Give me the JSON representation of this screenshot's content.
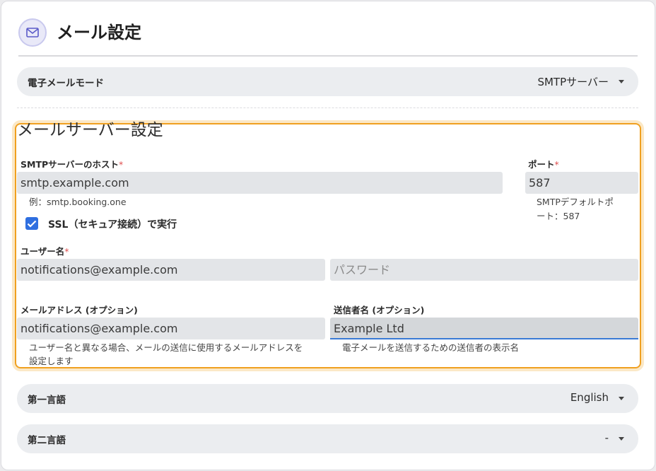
{
  "header": {
    "title": "メール設定",
    "icon": "mail-icon"
  },
  "mode": {
    "label": "電子メールモード",
    "value": "SMTPサーバー"
  },
  "server": {
    "title": "メールサーバー設定",
    "host": {
      "label": "SMTPサーバーのホスト",
      "value": "smtp.example.com",
      "help": "例：smtp.booking.one"
    },
    "port": {
      "label": "ポート",
      "value": "587",
      "help_line1": "SMTPデフォルトポ",
      "help_line2": "ート：587"
    },
    "ssl": {
      "label": "SSL（セキュア接続）で実行",
      "checked": true
    },
    "username": {
      "label": "ユーザー名",
      "value": "notifications@example.com"
    },
    "password": {
      "placeholder": "パスワード"
    },
    "email": {
      "label": "メールアドレス (オプション)",
      "value": "notifications@example.com",
      "help_line1": "ユーザー名と異なる場合、メールの送信に使用するメールアドレスを",
      "help_line2": "設定します"
    },
    "sender": {
      "label": "送信者名 (オプション)",
      "value": "Example Ltd",
      "help": "電子メールを送信するための送信者の表示名"
    }
  },
  "primary_language": {
    "label": "第一言語",
    "value": "English"
  },
  "secondary_language": {
    "label": "第二言語",
    "value": "-"
  },
  "colors": {
    "accent": "#2f6fe0",
    "highlight": "#f0a020",
    "required": "#e05050"
  }
}
